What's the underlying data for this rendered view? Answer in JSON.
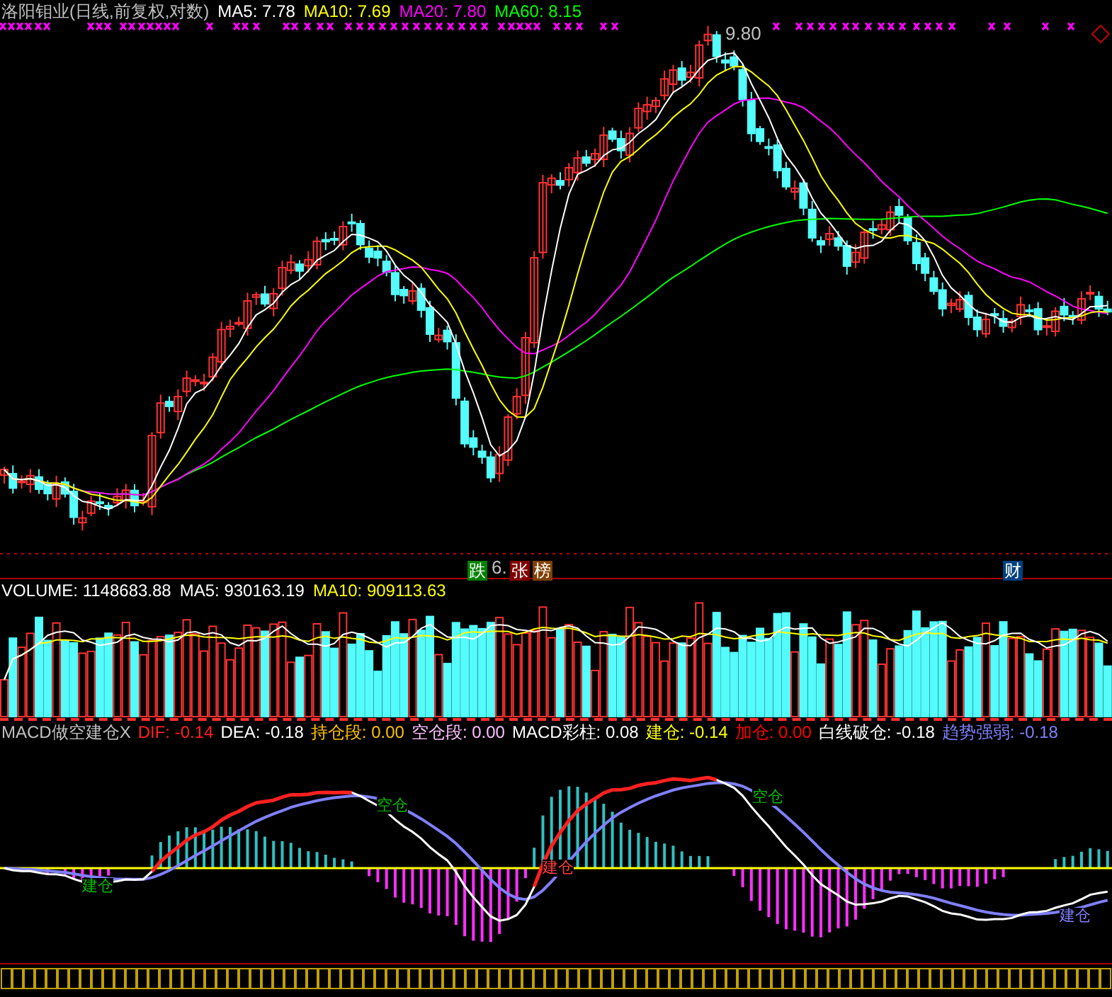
{
  "title": "洛阳钼业(日线,前复权,对数)",
  "main_legend": [
    {
      "label": "MA5: 7.78",
      "color": "#ffffff"
    },
    {
      "label": "MA10: 7.69",
      "color": "#ffff00"
    },
    {
      "label": "MA20: 7.80",
      "color": "#ff00ff"
    },
    {
      "label": "MA60: 8.15",
      "color": "#00ff00"
    }
  ],
  "high_label": "9.80",
  "low_label": "6.",
  "event_badges": [
    {
      "text": "跌",
      "color": "#008000"
    },
    {
      "text": "张",
      "color": "#800000"
    },
    {
      "text": "榜",
      "color": "#804000"
    },
    {
      "text": "财",
      "color": "#004080"
    }
  ],
  "volume_legend": [
    {
      "label": "VOLUME: 1148683.88",
      "color": "#ffffff"
    },
    {
      "label": "MA5: 930163.19",
      "color": "#ffffff"
    },
    {
      "label": "MA10: 909113.63",
      "color": "#ffff00"
    }
  ],
  "macd_legend": [
    {
      "label": "MACD做空建仓X",
      "color": "#c0c0c0"
    },
    {
      "label": "DIF: -0.14",
      "color": "#ff2020"
    },
    {
      "label": "DEA: -0.18",
      "color": "#ffffff"
    },
    {
      "label": "持仓段: 0.00",
      "color": "#ffc000"
    },
    {
      "label": "空仓段: 0.00",
      "color": "#ffc0ff"
    },
    {
      "label": "MACD彩柱: 0.08",
      "color": "#ffffff"
    },
    {
      "label": "建仓: -0.14",
      "color": "#ffff00"
    },
    {
      "label": "加仓: 0.00",
      "color": "#ff0000"
    },
    {
      "label": "白线破仓: -0.18",
      "color": "#ffffff"
    },
    {
      "label": "趋势强弱: -0.18",
      "color": "#8080ff"
    }
  ],
  "macd_markers": [
    {
      "text": "建仓",
      "color": "#00c000"
    },
    {
      "text": "空仓",
      "color": "#00c000"
    },
    {
      "text": "建仓",
      "color": "#ff4040"
    },
    {
      "text": "空仓",
      "color": "#00c000"
    },
    {
      "text": "建仓",
      "color": "#8080ff"
    }
  ]
}
